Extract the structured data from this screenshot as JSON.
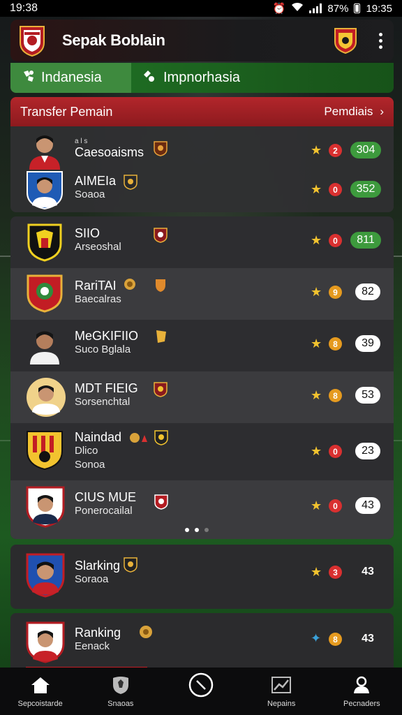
{
  "status_bar": {
    "time_left": "19:38",
    "battery": "87%",
    "time_right": "19:35"
  },
  "app": {
    "title": "Sepak Boblain"
  },
  "tabs": [
    {
      "label": "Indanesia",
      "icon": "soccer-icon"
    },
    {
      "label": "Impnorhasia",
      "icon": "ball-icon"
    }
  ],
  "transfer": {
    "title": "Transfer Pemain",
    "link": "Pemdiais"
  },
  "players": [
    {
      "l0": "a l s",
      "name": "Caesoaisms",
      "sub": "",
      "circle": "2",
      "score": "304"
    },
    {
      "l0": "",
      "name": "AIMEIa",
      "sub": "Soaoa",
      "circle": "0",
      "score": "352"
    },
    {
      "l0": "",
      "name": "SIIO",
      "sub": "Arseoshal",
      "circle": "0",
      "score": "811"
    },
    {
      "l0": "",
      "name": "RariTAI",
      "sub": "Baecalras",
      "circle": "9",
      "score": "82"
    },
    {
      "l0": "",
      "name": "MeGKIFIIO",
      "sub": "Suco Bglala",
      "circle": "8",
      "score": "39"
    },
    {
      "l0": "",
      "name": "MDT FIEIG",
      "sub": "Sorsenchtal",
      "circle": "8",
      "score": "53"
    },
    {
      "l0": "",
      "name": "Naindad",
      "sub": "Dlico",
      "sub2": "Sonoa",
      "circle": "0",
      "score": "23"
    },
    {
      "l0": "",
      "name": "CIUS MUE",
      "sub": "Ponerocailal",
      "circle": "0",
      "score": "43"
    },
    {
      "l0": "",
      "name": "Slarking",
      "sub": "Soraoa",
      "circle": "3",
      "score": "43"
    },
    {
      "l0": "",
      "name": "Ranking",
      "sub": "Eenack",
      "circle": "8",
      "score": "43"
    }
  ],
  "nav": [
    {
      "label": "Sepcoistarde",
      "icon": "home-icon"
    },
    {
      "label": "Snaoas",
      "icon": "shield-icon"
    },
    {
      "label": "",
      "icon": "compass-icon"
    },
    {
      "label": "Nepains",
      "icon": "chart-icon"
    },
    {
      "label": "Pecnaders",
      "icon": "person-icon"
    }
  ],
  "colors": {
    "accent_red": "#b2262b",
    "accent_green": "#3d9a3d",
    "star": "#f2c32f",
    "circle_red": "#d93030",
    "circle_orange": "#e59a1f"
  }
}
